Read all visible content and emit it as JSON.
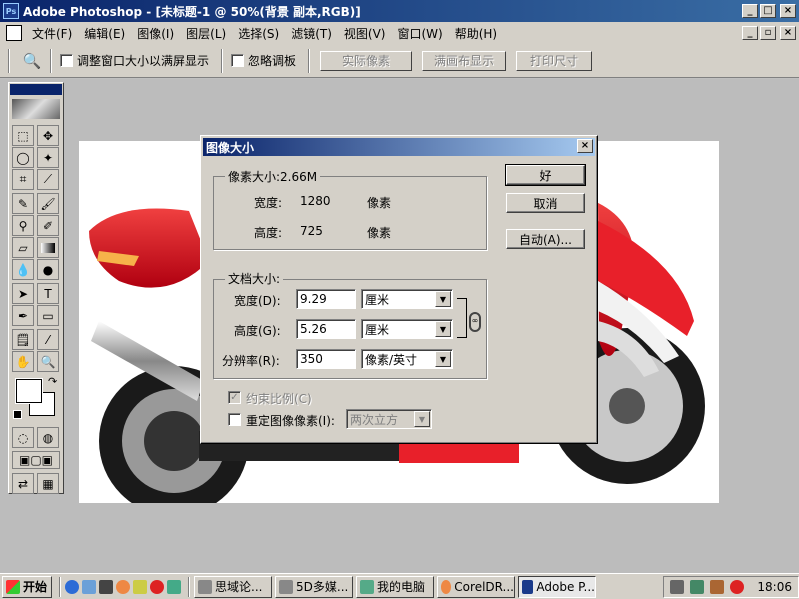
{
  "window": {
    "title": "Adobe Photoshop - [未标题-1 @ 50%(背景 副本,RGB)]",
    "buttons": [
      "_",
      "□",
      "×"
    ],
    "doc_buttons": [
      "_",
      "▫",
      "×"
    ]
  },
  "menu": {
    "items": [
      "文件(F)",
      "编辑(E)",
      "图像(I)",
      "图层(L)",
      "选择(S)",
      "滤镜(T)",
      "视图(V)",
      "窗口(W)",
      "帮助(H)"
    ]
  },
  "options": {
    "resize_windows_label": "调整窗口大小以满屏显示",
    "ignore_palettes_label": "忽略调板",
    "actual_pixels": "实际像素",
    "fit_on_screen": "满画布显示",
    "print_size": "打印尺寸"
  },
  "dialog": {
    "title": "图像大小",
    "pixel_dimensions_label": "像素大小:2.66M",
    "width_label": "宽度:",
    "width_value": "1280",
    "width_unit": "像素",
    "height_label": "高度:",
    "height_value": "725",
    "height_unit": "像素",
    "doc_size_label": "文档大小:",
    "doc_width_label": "宽度(D):",
    "doc_width_value": "9.29",
    "doc_width_unit": "厘米",
    "doc_height_label": "高度(G):",
    "doc_height_value": "5.26",
    "doc_height_unit": "厘米",
    "resolution_label": "分辨率(R):",
    "resolution_value": "350",
    "resolution_unit": "像素/英寸",
    "constrain_label": "约束比例(C)",
    "resample_label": "重定图像像素(I):",
    "resample_method": "两次立方",
    "ok": "好",
    "cancel": "取消",
    "auto": "自动(A)..."
  },
  "taskbar": {
    "start": "开始",
    "tasks": [
      "思域论...",
      "5D多媒...",
      "我的电脑",
      "CorelDR...",
      "Adobe P..."
    ],
    "clock": "18:06"
  },
  "colors": {
    "titlebar_start": "#0a246a",
    "titlebar_end": "#3a6ea5",
    "motorcycle_red": "#e8202a",
    "face": "#d4d0c8"
  }
}
